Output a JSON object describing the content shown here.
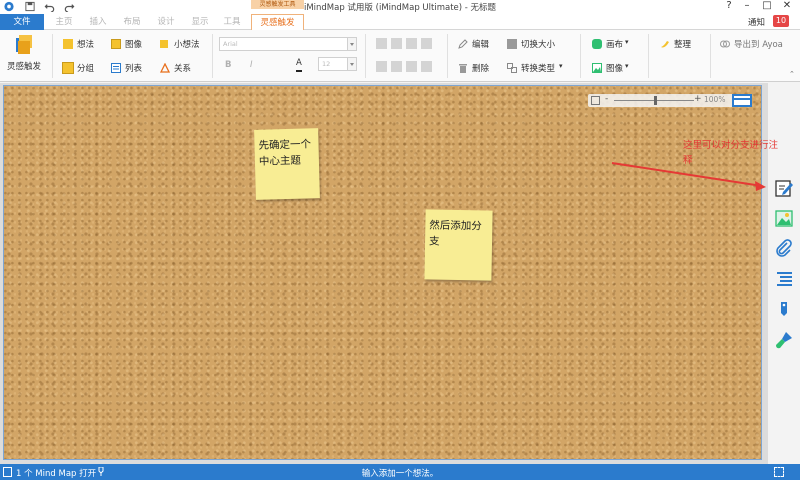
{
  "window": {
    "title": "iMindMap 试用版 (iMindMap Ultimate) - 无标题",
    "context_tab_group": "灵感触发工具",
    "controls": {
      "help": "?",
      "minimize": "–",
      "maximize": "□",
      "close": "✕"
    }
  },
  "tabs": [
    {
      "label": "文件"
    },
    {
      "label": "主页"
    },
    {
      "label": "插入"
    },
    {
      "label": "布局"
    },
    {
      "label": "设计"
    },
    {
      "label": "显示"
    },
    {
      "label": "工具"
    },
    {
      "label": "灵感触发"
    }
  ],
  "notifications": {
    "label": "通知",
    "count": "10"
  },
  "ribbon": {
    "brainstorm_button": "灵感触发",
    "idea": "想法",
    "image": "图像",
    "small_idea": "小想法",
    "group": "分组",
    "list": "列表",
    "relation": "关系",
    "font_name": "Arial",
    "font_size": "12",
    "bold": "B",
    "italic": "I",
    "font_color": "A",
    "edit": "编辑",
    "toggle_size": "切换大小",
    "delete": "删除",
    "convert_type": "转换类型",
    "canvas": "画布",
    "image_menu": "图像",
    "organize": "整理",
    "export_ayoa": "导出到 Ayoa"
  },
  "canvas": {
    "zoom": "100%",
    "notes": [
      {
        "text": "先确定一个中心主题"
      },
      {
        "text": "然后添加分支"
      }
    ],
    "annotation": "这里可以对分支进行注释"
  },
  "side_panel": {
    "icons": [
      "notes-edit-icon",
      "image-icon",
      "attachment-icon",
      "task-list-icon",
      "tag-icon",
      "paint-brush-icon"
    ]
  },
  "status": {
    "left": "1 个 Mind Map 打开",
    "center": "输入添加一个想法。"
  },
  "colors": {
    "accent_blue": "#2b7bcd",
    "active_tab": "#e86f1b",
    "cork": "#d2a566",
    "sticky_note": "#f8ed94",
    "annotation_red": "#e53935",
    "badge_red": "#e54646"
  }
}
